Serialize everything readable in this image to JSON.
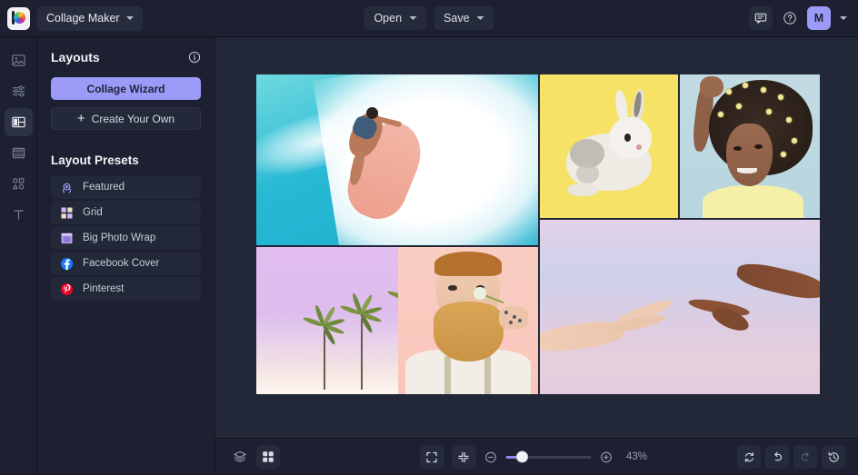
{
  "app": {
    "logo": "picmonkey-logo-icon",
    "project_title": "Collage Maker"
  },
  "header": {
    "open_label": "Open",
    "save_label": "Save",
    "chat_icon": "chat-bubble-icon",
    "help_icon": "help-circle-icon",
    "avatar_initial": "M"
  },
  "rail": {
    "items": [
      {
        "icon": "image-icon",
        "name": "photos",
        "active": false
      },
      {
        "icon": "sliders-icon",
        "name": "adjust",
        "active": false
      },
      {
        "icon": "layouts-icon",
        "name": "layouts",
        "active": true
      },
      {
        "icon": "textures-icon",
        "name": "textures",
        "active": false
      },
      {
        "icon": "graphics-icon",
        "name": "graphics",
        "active": false
      },
      {
        "icon": "text-icon",
        "name": "text",
        "active": false
      }
    ]
  },
  "panel": {
    "title": "Layouts",
    "info_icon": "info-circle-icon",
    "wizard_button": "Collage Wizard",
    "create_button": "Create Your Own",
    "presets_title": "Layout Presets",
    "presets": [
      {
        "label": "Featured",
        "icon": "featured-badge-icon"
      },
      {
        "label": "Grid",
        "icon": "grid-icon"
      },
      {
        "label": "Big Photo Wrap",
        "icon": "big-photo-wrap-icon"
      },
      {
        "label": "Facebook Cover",
        "icon": "facebook-icon"
      },
      {
        "label": "Pinterest",
        "icon": "pinterest-icon"
      }
    ]
  },
  "canvas": {
    "cells": [
      {
        "name": "surfer-photo",
        "alt": "Woman surfing on turquoise wave"
      },
      {
        "name": "palm-trees-photo",
        "alt": "Palm trees on lavender sky"
      },
      {
        "name": "rabbit-photo",
        "alt": "White rabbit on yellow background"
      },
      {
        "name": "woman-flowers-photo",
        "alt": "Woman with flowers in afro hair"
      },
      {
        "name": "bearded-man-photo",
        "alt": "Bearded man with flower on pink background"
      },
      {
        "name": "hands-photo",
        "alt": "Two hands reaching toward each other"
      }
    ]
  },
  "bottombar": {
    "layers_icon": "layers-icon",
    "thumbnails_icon": "grid-squares-icon",
    "fullscreen_icon": "fullscreen-icon",
    "fit_icon": "fit-to-screen-icon",
    "zoom_out_icon": "zoom-out-icon",
    "zoom_in_icon": "zoom-in-icon",
    "zoom_level": "43%",
    "zoom_slider_percent": 20,
    "reset_icon": "reset-icon",
    "undo_icon": "undo-icon",
    "redo_icon": "redo-icon",
    "history_icon": "history-icon"
  },
  "colors": {
    "accent": "#9b9bf7",
    "panel_bg": "#1c2030",
    "canvas_bg": "#232839"
  }
}
